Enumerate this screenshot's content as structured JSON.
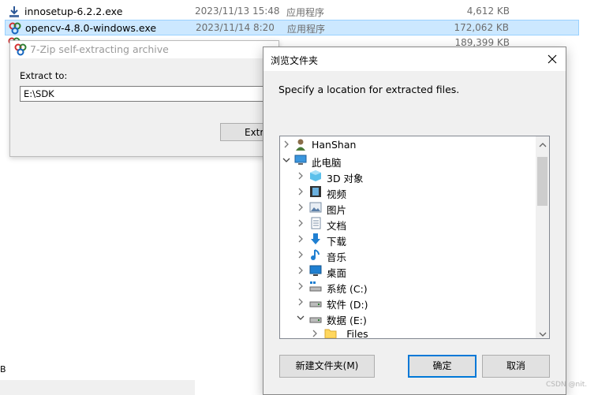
{
  "explorer": {
    "files": [
      {
        "name": "innosetup-6.2.2.exe",
        "date": "2023/11/13 15:48",
        "type": "应用程序",
        "size": "4,612 KB",
        "icon": "installer-icon"
      },
      {
        "name": "opencv-4.8.0-windows.exe",
        "date": "2023/11/14 8:20",
        "type": "应用程序",
        "size": "172,062 KB",
        "icon": "7zip-sfx-icon"
      },
      {
        "name": "",
        "date": "",
        "type": "",
        "size": "189,399 KB",
        "icon": "7zip-sfx-icon"
      }
    ],
    "bottom_fragment": "B"
  },
  "sfx_window": {
    "title": "7-Zip self-extracting archive",
    "extract_label": "Extract to:",
    "path_value": "E:\\SDK",
    "extract_button": "Extract"
  },
  "browse_dialog": {
    "title": "浏览文件夹",
    "prompt": "Specify a location for extracted files.",
    "tree": [
      {
        "label": "HanShan",
        "level": 0,
        "arrow": "right",
        "icon": "user-icon"
      },
      {
        "label": "此电脑",
        "level": 0,
        "arrow": "down",
        "icon": "computer-icon"
      },
      {
        "label": "3D 对象",
        "level": 1,
        "arrow": "right",
        "icon": "3d-objects-icon"
      },
      {
        "label": "视频",
        "level": 1,
        "arrow": "right",
        "icon": "video-icon"
      },
      {
        "label": "图片",
        "level": 1,
        "arrow": "right",
        "icon": "pictures-icon"
      },
      {
        "label": "文档",
        "level": 1,
        "arrow": "right",
        "icon": "documents-icon"
      },
      {
        "label": "下载",
        "level": 1,
        "arrow": "right",
        "icon": "download-icon"
      },
      {
        "label": "音乐",
        "level": 1,
        "arrow": "right",
        "icon": "music-icon"
      },
      {
        "label": "桌面",
        "level": 1,
        "arrow": "right",
        "icon": "desktop-icon"
      },
      {
        "label": "系统 (C:)",
        "level": 1,
        "arrow": "right",
        "icon": "system-drive-icon"
      },
      {
        "label": "软件 (D:)",
        "level": 1,
        "arrow": "right",
        "icon": "drive-icon"
      },
      {
        "label": "数据 (E:)",
        "level": 1,
        "arrow": "down",
        "icon": "drive-icon"
      },
      {
        "label": "_Files",
        "level": 2,
        "arrow": "right",
        "icon": "folder-icon"
      }
    ],
    "buttons": {
      "new_folder": "新建文件夹(M)",
      "ok": "确定",
      "cancel": "取消"
    }
  },
  "watermark": "CSDN @nit.",
  "colors": {
    "selection": "#cce8ff",
    "accent": "#0078d7",
    "folder": "#ffd75e"
  }
}
